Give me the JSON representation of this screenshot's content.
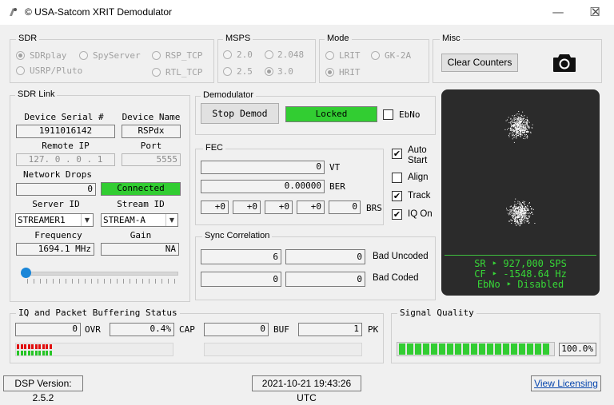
{
  "window": {
    "title": "© USA-Satcom XRIT Demodulator",
    "minimize": "—",
    "maximize": "☐",
    "close": "✕"
  },
  "sdr": {
    "label": "SDR",
    "options": [
      {
        "label": "SDRplay",
        "selected": true
      },
      {
        "label": "SpyServer",
        "selected": false
      },
      {
        "label": "RSP_TCP",
        "selected": false
      },
      {
        "label": "USRP/Pluto",
        "selected": false
      },
      {
        "label": "RTL_TCP",
        "selected": false
      }
    ]
  },
  "msps": {
    "label": "MSPS",
    "options": [
      "2.0",
      "2.048",
      "2.5",
      "3.0"
    ],
    "selected": "3.0"
  },
  "mode": {
    "label": "Mode",
    "options": [
      "LRIT",
      "GK-2A",
      "HRIT"
    ],
    "selected": "HRIT"
  },
  "misc": {
    "label": "Misc",
    "clear_counters": "Clear Counters",
    "camera": "camera-icon"
  },
  "sdr_link": {
    "label": "SDR Link",
    "device_serial_label": "Device Serial #",
    "device_serial": "1911016142",
    "device_name_label": "Device Name",
    "device_name": "RSPdx",
    "remote_ip_label": "Remote IP",
    "remote_ip": "127. 0 . 0 . 1",
    "port_label": "Port",
    "port": "5555",
    "network_drops_label": "Network Drops",
    "network_drops": "0",
    "connection_status": "Connected",
    "server_id_label": "Server ID",
    "server_id": "STREAMER1",
    "stream_id_label": "Stream ID",
    "stream_id": "STREAM-A",
    "frequency_label": "Frequency",
    "frequency": "1694.1 MHz",
    "gain_label": "Gain",
    "gain": "NA",
    "gain_slider": 0
  },
  "demodulator": {
    "label": "Demodulator",
    "stop_button": "Stop Demod",
    "status": "Locked",
    "ebno_label": "EbNo",
    "ebno_checked": false
  },
  "fec": {
    "label": "FEC",
    "vt": "0",
    "vt_label": "VT",
    "ber": "0.00000",
    "ber_label": "BER",
    "brs": [
      "+0",
      "+0",
      "+0",
      "+0",
      "0"
    ],
    "brs_label": "BRS"
  },
  "options": [
    {
      "label": "Auto",
      "label2": "Start",
      "checked": true
    },
    {
      "label": "Align",
      "label2": "",
      "checked": false
    },
    {
      "label": "Track",
      "label2": "",
      "checked": true
    },
    {
      "label": "IQ On",
      "label2": "",
      "checked": true
    }
  ],
  "sync": {
    "label": "Sync Correlation",
    "row1": [
      "6",
      "0"
    ],
    "row1_label": "Bad Uncoded",
    "row2": [
      "0",
      "0"
    ],
    "row2_label": "Bad Coded"
  },
  "constellation": {
    "sr": "SR ‣ 927,000 SPS",
    "cf": "CF ‣ -1548.64 Hz",
    "ebno": "EbNo ‣ Disabled",
    "text_color": "#37d737"
  },
  "buffering": {
    "label": "IQ and Packet Buffering Status",
    "ovr": "0",
    "ovr_label": "OVR",
    "cap": "0.4%",
    "cap_label": "CAP",
    "buf": "0",
    "buf_label": "BUF",
    "pk": "1",
    "pk_label": "PK",
    "red_level": 0.43,
    "green_level": 0.43
  },
  "signal_quality": {
    "label": "Signal Quality",
    "value": "100.0%",
    "level": 1.0
  },
  "status_bar": {
    "dsp_version": "DSP Version: 2.5.2",
    "timestamp": "2021-10-21 19:43:26 UTC",
    "licensing": "View Licensing"
  },
  "colors": {
    "green": "#32cd32",
    "red": "#e01010",
    "led_green": "#27c527"
  }
}
